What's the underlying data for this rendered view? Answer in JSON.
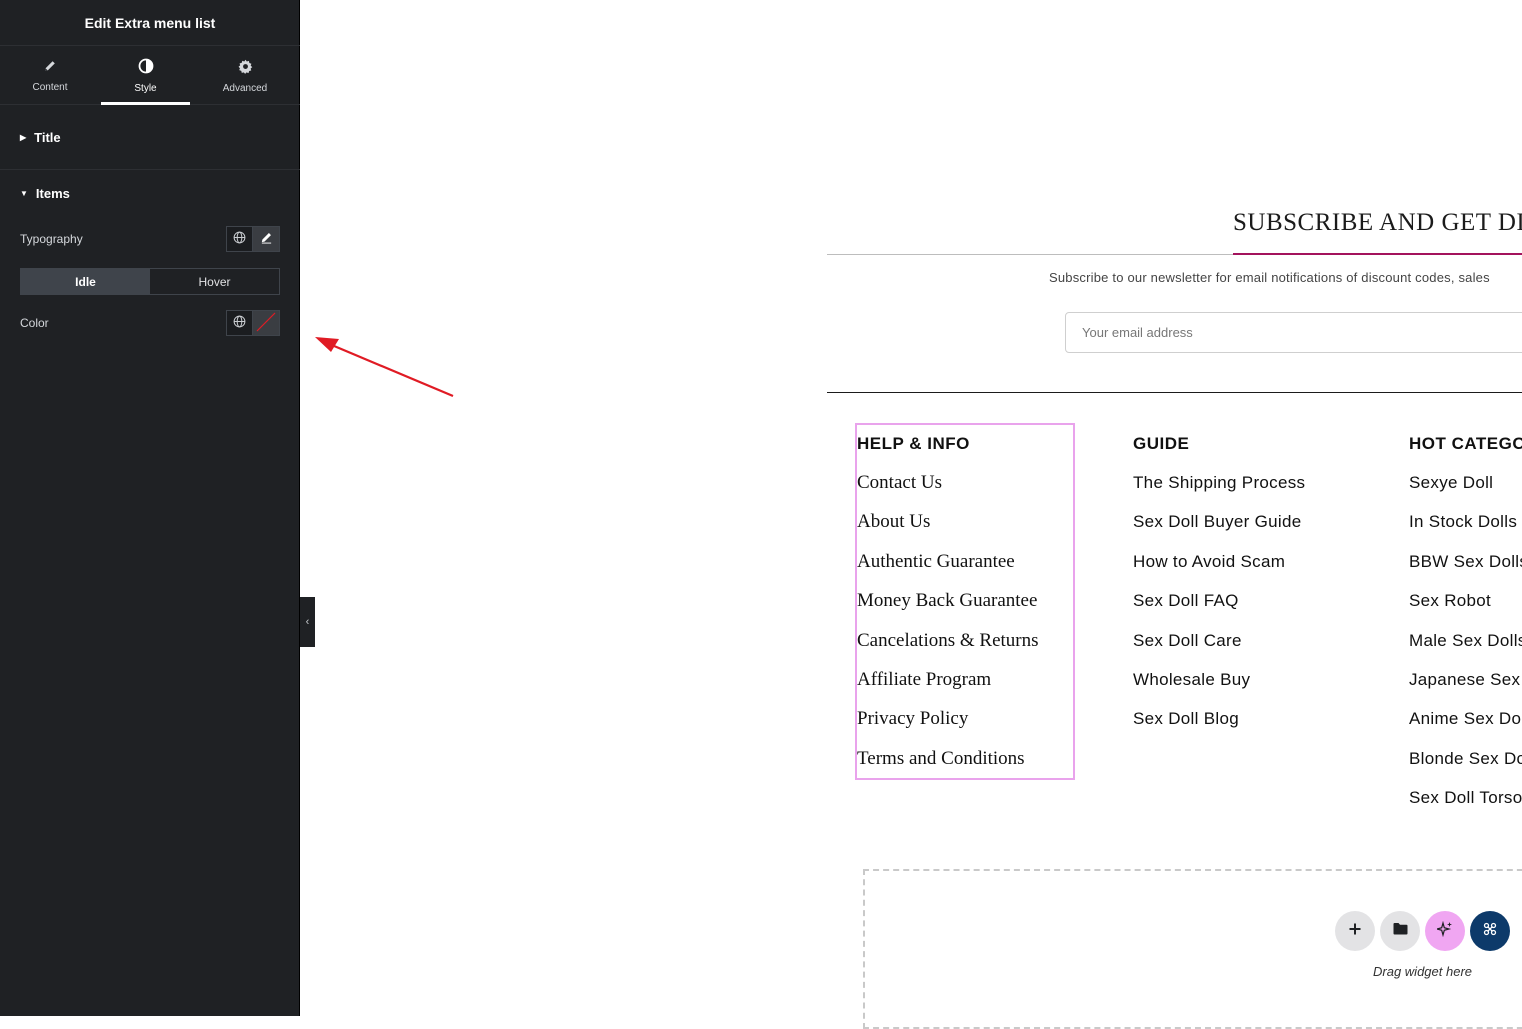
{
  "panel": {
    "title": "Edit Extra menu list",
    "tabs": [
      {
        "label": "Content",
        "icon": "pencil-icon"
      },
      {
        "label": "Style",
        "icon": "contrast-icon"
      },
      {
        "label": "Advanced",
        "icon": "gear-icon"
      }
    ],
    "active_tab": "Style",
    "sections": {
      "title_label": "Title",
      "items_label": "Items"
    },
    "controls": {
      "typography_label": "Typography",
      "state_tabs": [
        "Idle",
        "Hover"
      ],
      "active_state": "Idle",
      "color_label": "Color"
    }
  },
  "canvas": {
    "subscribe": {
      "heading": "SUBSCRIBE AND GET DIS",
      "text": "Subscribe to our newsletter for email notifications of discount codes, sales",
      "email_placeholder": "Your email address"
    },
    "columns": [
      {
        "heading": "HELP & INFO",
        "items": [
          "Contact Us",
          "About Us",
          "Authentic Guarantee",
          "Money Back Guarantee",
          "Cancelations & Returns",
          "Affiliate Program",
          "Privacy Policy",
          "Terms and Conditions"
        ]
      },
      {
        "heading": "GUIDE",
        "items": [
          "The Shipping Process",
          "Sex Doll Buyer Guide",
          "How to Avoid Scam",
          "Sex Doll FAQ",
          "Sex Doll Care",
          "Wholesale Buy",
          "Sex Doll Blog"
        ]
      },
      {
        "heading": "HOT CATEGOR",
        "items": [
          "Sexye Doll",
          "In Stock Dolls",
          "BBW Sex Dolls",
          "Sex Robot",
          "Male Sex Dolls",
          "Japanese Sex",
          "Anime Sex Do",
          "Blonde Sex Dc",
          "Sex Doll Torso"
        ]
      }
    ],
    "drop_zone": {
      "text": "Drag widget here"
    }
  },
  "colors": {
    "panel_bg": "#1f2124",
    "accent_underline": "#a3135c",
    "selection_outline": "#e9a3ec",
    "arrow": "#e01b24",
    "ai_button": "#f0a6f2",
    "brand_button": "#0d3a6a"
  }
}
